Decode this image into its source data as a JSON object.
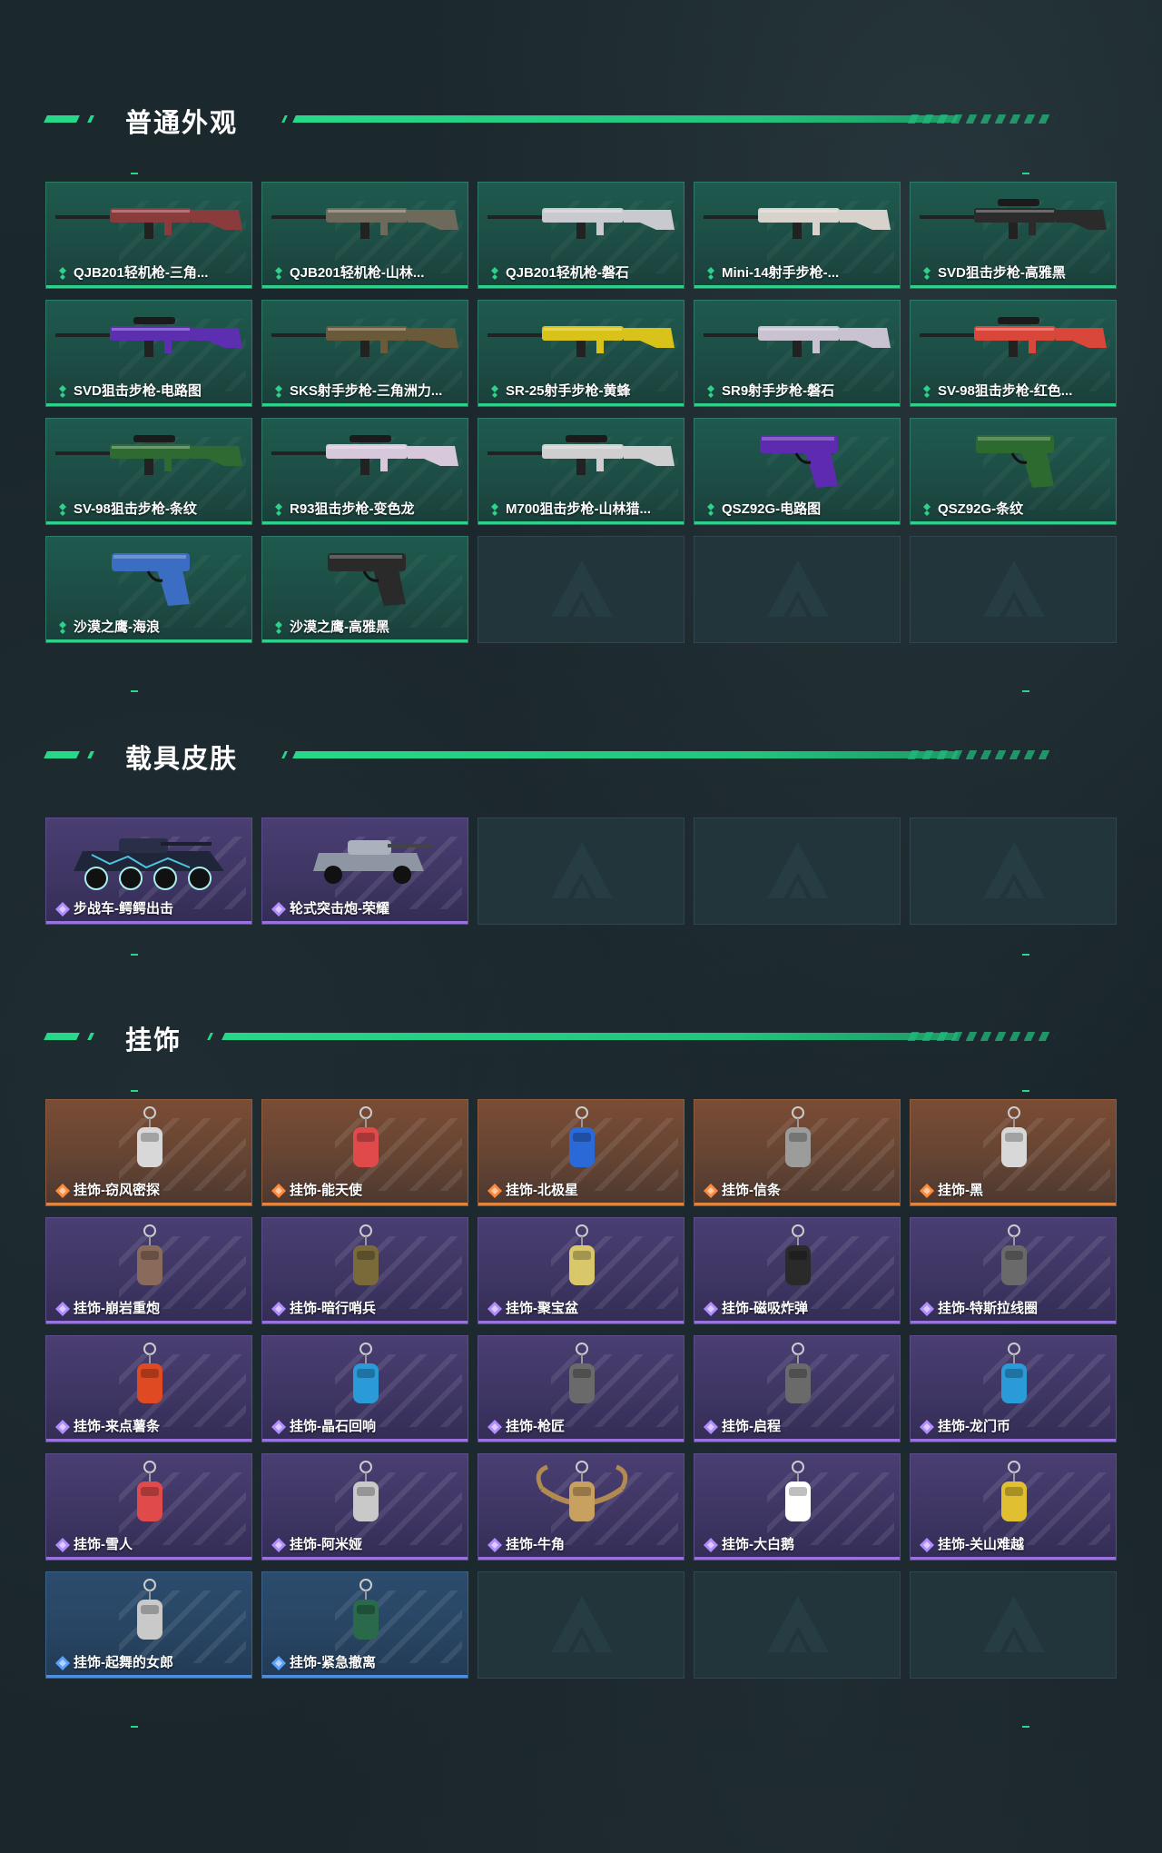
{
  "colors": {
    "accent": "#27d88a",
    "rarity_green": "#2fd08a",
    "rarity_orange": "#e0843e",
    "rarity_purple": "#9a72e0",
    "rarity_blue": "#4f8fe0"
  },
  "sections": {
    "weapons": {
      "title": "普通外观",
      "items": [
        {
          "label": "QJB201轻机枪-三角...",
          "rarity": "green",
          "icon": "light-machine-gun-icon"
        },
        {
          "label": "QJB201轻机枪-山林...",
          "rarity": "green",
          "icon": "light-machine-gun-icon"
        },
        {
          "label": "QJB201轻机枪-磐石",
          "rarity": "green",
          "icon": "light-machine-gun-icon"
        },
        {
          "label": "Mini-14射手步枪-...",
          "rarity": "green",
          "icon": "marksman-rifle-icon"
        },
        {
          "label": "SVD狙击步枪-高雅黑",
          "rarity": "green",
          "icon": "sniper-rifle-icon"
        },
        {
          "label": "SVD狙击步枪-电路图",
          "rarity": "green",
          "icon": "sniper-rifle-icon"
        },
        {
          "label": "SKS射手步枪-三角洲力...",
          "rarity": "green",
          "icon": "marksman-rifle-icon"
        },
        {
          "label": "SR-25射手步枪-黄蜂",
          "rarity": "green",
          "icon": "marksman-rifle-icon"
        },
        {
          "label": "SR9射手步枪-磐石",
          "rarity": "green",
          "icon": "marksman-rifle-icon"
        },
        {
          "label": "SV-98狙击步枪-红色...",
          "rarity": "green",
          "icon": "sniper-rifle-icon"
        },
        {
          "label": "SV-98狙击步枪-条纹",
          "rarity": "green",
          "icon": "sniper-rifle-icon"
        },
        {
          "label": "R93狙击步枪-变色龙",
          "rarity": "green",
          "icon": "sniper-rifle-icon"
        },
        {
          "label": "M700狙击步枪-山林猎...",
          "rarity": "green",
          "icon": "sniper-rifle-icon"
        },
        {
          "label": "QSZ92G-电路图",
          "rarity": "green",
          "icon": "pistol-icon"
        },
        {
          "label": "QSZ92G-条纹",
          "rarity": "green",
          "icon": "pistol-icon"
        },
        {
          "label": "沙漠之鹰-海浪",
          "rarity": "green",
          "icon": "pistol-icon"
        },
        {
          "label": "沙漠之鹰-高雅黑",
          "rarity": "green",
          "icon": "pistol-icon"
        }
      ],
      "empty_slots": 3
    },
    "vehicles": {
      "title": "载具皮肤",
      "items": [
        {
          "label": "步战车-鳄鳄出击",
          "rarity": "purple",
          "icon": "armored-vehicle-icon"
        },
        {
          "label": "轮式突击炮-荣耀",
          "rarity": "purple",
          "icon": "wheeled-assault-gun-icon"
        }
      ],
      "empty_slots": 3
    },
    "charms": {
      "title": "挂饰",
      "items": [
        {
          "label": "挂饰-窃风密探",
          "rarity": "orange",
          "icon": "charm-icon"
        },
        {
          "label": "挂饰-能天使",
          "rarity": "orange",
          "icon": "charm-icon"
        },
        {
          "label": "挂饰-北极星",
          "rarity": "orange",
          "icon": "charm-icon"
        },
        {
          "label": "挂饰-信条",
          "rarity": "orange",
          "icon": "charm-icon"
        },
        {
          "label": "挂饰-黑",
          "rarity": "orange",
          "icon": "charm-icon"
        },
        {
          "label": "挂饰-崩岩重炮",
          "rarity": "purple",
          "icon": "charm-icon"
        },
        {
          "label": "挂饰-暗行哨兵",
          "rarity": "purple",
          "icon": "charm-icon"
        },
        {
          "label": "挂饰-聚宝盆",
          "rarity": "purple",
          "icon": "charm-icon"
        },
        {
          "label": "挂饰-磁吸炸弹",
          "rarity": "purple",
          "icon": "charm-icon"
        },
        {
          "label": "挂饰-特斯拉线圈",
          "rarity": "purple",
          "icon": "charm-icon"
        },
        {
          "label": "挂饰-来点薯条",
          "rarity": "purple",
          "icon": "charm-icon"
        },
        {
          "label": "挂饰-晶石回响",
          "rarity": "purple",
          "icon": "charm-icon"
        },
        {
          "label": "挂饰-枪匠",
          "rarity": "purple",
          "icon": "charm-icon"
        },
        {
          "label": "挂饰-启程",
          "rarity": "purple",
          "icon": "charm-icon"
        },
        {
          "label": "挂饰-龙门币",
          "rarity": "purple",
          "icon": "charm-icon"
        },
        {
          "label": "挂饰-雪人",
          "rarity": "purple",
          "icon": "charm-icon"
        },
        {
          "label": "挂饰-阿米娅",
          "rarity": "purple",
          "icon": "charm-icon"
        },
        {
          "label": "挂饰-牛角",
          "rarity": "purple",
          "icon": "charm-icon"
        },
        {
          "label": "挂饰-大白鹅",
          "rarity": "purple",
          "icon": "charm-icon"
        },
        {
          "label": "挂饰-关山难越",
          "rarity": "purple",
          "icon": "charm-icon"
        },
        {
          "label": "挂饰-起舞的女郎",
          "rarity": "blue",
          "icon": "charm-icon"
        },
        {
          "label": "挂饰-紧急撤离",
          "rarity": "blue",
          "icon": "charm-icon"
        }
      ],
      "empty_slots": 3
    }
  }
}
